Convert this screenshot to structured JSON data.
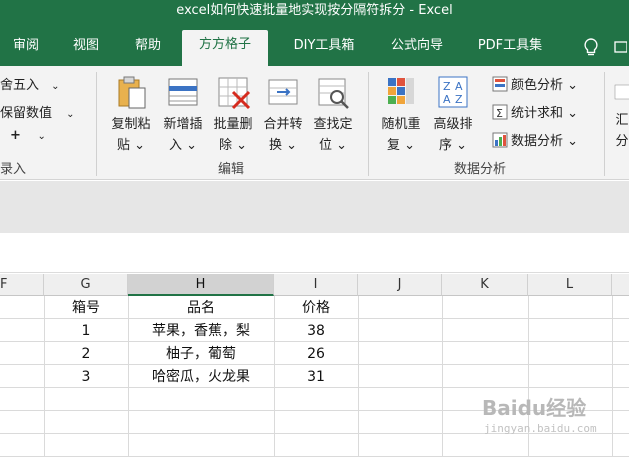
{
  "window": {
    "title": "excel如何快速批量地实现按分隔符拆分 - Excel"
  },
  "tabs": [
    {
      "label": "审阅",
      "active": false
    },
    {
      "label": "视图",
      "active": false
    },
    {
      "label": "帮助",
      "active": false
    },
    {
      "label": "方方格子",
      "active": true
    },
    {
      "label": "DIY工具箱",
      "active": false
    },
    {
      "label": "公式向导",
      "active": false
    },
    {
      "label": "PDF工具集",
      "active": false
    }
  ],
  "ribbon": {
    "left_items": [
      "舍五入",
      "保留数值",
      "+",
      "录入"
    ],
    "left_items_arrows": [
      "⌄",
      "⌄",
      "⌄"
    ],
    "edit_buttons": [
      {
        "line1": "复制粘",
        "line2": "贴 ⌄"
      },
      {
        "line1": "新增插",
        "line2": "入 ⌄"
      },
      {
        "line1": "批量删",
        "line2": "除 ⌄"
      },
      {
        "line1": "合并转",
        "line2": "换 ⌄"
      },
      {
        "line1": "查找定",
        "line2": "位 ⌄"
      }
    ],
    "edit_group_label": "编辑",
    "analysis_buttons": [
      {
        "line1": "随机重",
        "line2": "复 ⌄"
      },
      {
        "line1": "高级排",
        "line2": "序 ⌄"
      }
    ],
    "analysis_small": [
      "颜色分析 ⌄",
      "统计求和 ⌄",
      "数据分析 ⌄"
    ],
    "analysis_group_label": "数据分析",
    "right_partial": {
      "line1": "汇",
      "line2": "分"
    }
  },
  "sheet": {
    "columns": [
      "F",
      "G",
      "H",
      "I",
      "J",
      "K",
      "L"
    ],
    "header": {
      "g": "箱号",
      "h": "品名",
      "i": "价格"
    },
    "rows": [
      {
        "g": "1",
        "h": "苹果，香蕉，梨",
        "i": "38"
      },
      {
        "g": "2",
        "h": "柚子，葡萄",
        "i": "26"
      },
      {
        "g": "3",
        "h": "哈密瓜，火龙果",
        "i": "31"
      }
    ]
  },
  "watermark": {
    "main": "Baidu经验",
    "sub": "jingyan.baidu.com"
  },
  "colors": {
    "excel_green": "#217346",
    "ribbon_bg": "#f3f3f3"
  }
}
